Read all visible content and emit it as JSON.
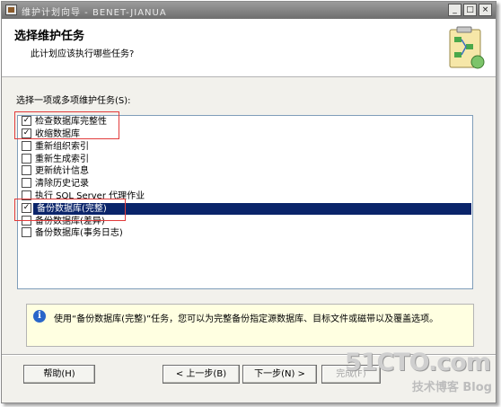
{
  "window": {
    "title": "维护计划向导 - BENET-JIANUA",
    "controls": {
      "minimize": "_",
      "maximize": "□",
      "close": "×"
    }
  },
  "header": {
    "title": "选择维护任务",
    "subtitle": "此计划应该执行哪些任务?",
    "icon": "wizard-clipboard-icon"
  },
  "tasks": {
    "label": "选择一项或多项维护任务(S):",
    "items": [
      {
        "label": "检查数据库完整性",
        "checked": true,
        "selected": false
      },
      {
        "label": "收缩数据库",
        "checked": true,
        "selected": false
      },
      {
        "label": "重新组织索引",
        "checked": false,
        "selected": false
      },
      {
        "label": "重新生成索引",
        "checked": false,
        "selected": false
      },
      {
        "label": "更新统计信息",
        "checked": false,
        "selected": false
      },
      {
        "label": "清除历史记录",
        "checked": false,
        "selected": false
      },
      {
        "label": "执行 SQL Server 代理作业",
        "checked": false,
        "selected": false
      },
      {
        "label": "备份数据库(完整)",
        "checked": true,
        "selected": true
      },
      {
        "label": "备份数据库(差异)",
        "checked": false,
        "selected": false
      },
      {
        "label": "备份数据库(事务日志)",
        "checked": false,
        "selected": false
      }
    ]
  },
  "info": {
    "icon": "info-icon",
    "text": "使用“备份数据库(完整)”任务，您可以为完整备份指定源数据库、目标文件或磁带以及覆盖选项。"
  },
  "buttons": {
    "help": "帮助(H)",
    "back": "< 上一步(B)",
    "next": "下一步(N) >",
    "finish": "完成(F)"
  },
  "watermark": {
    "site": "51CTO.com",
    "caption": "技术博客 Blog"
  },
  "colors": {
    "selection": "#0a246a",
    "highlight_box": "#e23b3b",
    "info_background": "#ffffe1"
  }
}
